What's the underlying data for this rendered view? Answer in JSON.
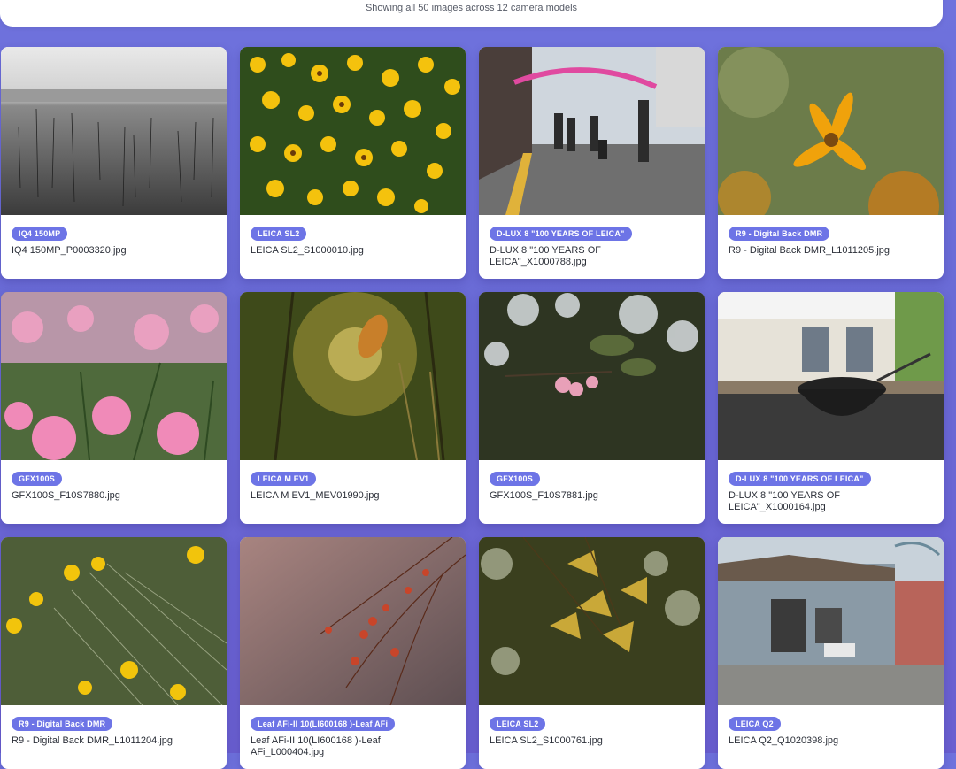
{
  "header": {
    "summary": "Showing all 50 images across 12 camera models"
  },
  "colors": {
    "accent": "#6d74e6",
    "background": "#6a6bd6"
  },
  "cards": [
    {
      "badge": "IQ4 150MP",
      "filename": "IQ4 150MP_P0003320.jpg",
      "photo": "bw-lake"
    },
    {
      "badge": "LEICA SL2",
      "filename": "LEICA SL2_S1000010.jpg",
      "photo": "yellow-flowers"
    },
    {
      "badge": "D-LUX 8 \"100 YEARS OF LEICA\"",
      "filename": "D-LUX 8 \"100 YEARS OF LEICA\"_X1000788.jpg",
      "photo": "street-scene"
    },
    {
      "badge": "R9 - Digital Back DMR",
      "filename": "R9 - Digital Back DMR_L1011205.jpg",
      "photo": "orange-flower"
    },
    {
      "badge": "GFX100S",
      "filename": "GFX100S_F10S7880.jpg",
      "photo": "pink-flowers"
    },
    {
      "badge": "LEICA M EV1",
      "filename": "LEICA M EV1_MEV01990.jpg",
      "photo": "backlit-leaf"
    },
    {
      "badge": "GFX100S",
      "filename": "GFX100S_F10S7881.jpg",
      "photo": "blossom-bokeh"
    },
    {
      "badge": "D-LUX 8 \"100 YEARS OF LEICA\"",
      "filename": "D-LUX 8 \"100 YEARS OF LEICA\"_X1000164.jpg",
      "photo": "noodle-bowl"
    },
    {
      "badge": "R9 - Digital Back DMR",
      "filename": "R9 - Digital Back DMR_L1011204.jpg",
      "photo": "yellow-wildflowers"
    },
    {
      "badge": "Leaf AFi-II 10(LI600168 )-Leaf AFi",
      "filename": "Leaf AFi-II 10(LI600168 )-Leaf AFi_L000404.jpg",
      "photo": "red-branches"
    },
    {
      "badge": "LEICA SL2",
      "filename": "LEICA SL2_S1000761.jpg",
      "photo": "ginkgo-leaves"
    },
    {
      "badge": "LEICA Q2",
      "filename": "LEICA Q2_Q1020398.jpg",
      "photo": "old-house"
    }
  ]
}
